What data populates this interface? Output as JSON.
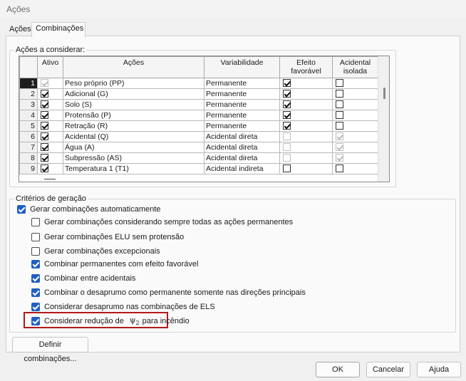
{
  "window": {
    "title": "Ações"
  },
  "tabs": [
    {
      "label": "Ações",
      "active": false
    },
    {
      "label": "Combinações",
      "active": true
    }
  ],
  "acoes_group": {
    "legend": "Ações a considerar:",
    "columns": [
      "",
      "Ativo",
      "Ações",
      "Variabilidade",
      "Efeito favorável",
      "Acidental isolada"
    ],
    "rows": [
      {
        "num": "1",
        "ativo": true,
        "ativo_disabled": true,
        "acao": "Peso próprio (PP)",
        "variabilidade": "Permanente",
        "efeito_favoravel": true,
        "efeito_disabled": false,
        "acidental_isolada": false,
        "acidental_disabled": false,
        "current": true
      },
      {
        "num": "2",
        "ativo": true,
        "ativo_disabled": false,
        "acao": "Adicional (G)",
        "variabilidade": "Permanente",
        "efeito_favoravel": true,
        "efeito_disabled": false,
        "acidental_isolada": false,
        "acidental_disabled": false
      },
      {
        "num": "3",
        "ativo": true,
        "ativo_disabled": false,
        "acao": "Solo (S)",
        "variabilidade": "Permanente",
        "efeito_favoravel": true,
        "efeito_disabled": false,
        "acidental_isolada": false,
        "acidental_disabled": false
      },
      {
        "num": "4",
        "ativo": true,
        "ativo_disabled": false,
        "acao": "Protensão (P)",
        "variabilidade": "Permanente",
        "efeito_favoravel": true,
        "efeito_disabled": false,
        "acidental_isolada": false,
        "acidental_disabled": false
      },
      {
        "num": "5",
        "ativo": true,
        "ativo_disabled": false,
        "acao": "Retração (R)",
        "variabilidade": "Permanente",
        "efeito_favoravel": true,
        "efeito_disabled": false,
        "acidental_isolada": false,
        "acidental_disabled": false
      },
      {
        "num": "6",
        "ativo": true,
        "ativo_disabled": false,
        "acao": "Acidental (Q)",
        "variabilidade": "Acidental direta",
        "efeito_favoravel": false,
        "efeito_disabled": true,
        "acidental_isolada": true,
        "acidental_disabled": true
      },
      {
        "num": "7",
        "ativo": true,
        "ativo_disabled": false,
        "acao": "Água (A)",
        "variabilidade": "Acidental direta",
        "efeito_favoravel": false,
        "efeito_disabled": true,
        "acidental_isolada": true,
        "acidental_disabled": true
      },
      {
        "num": "8",
        "ativo": true,
        "ativo_disabled": false,
        "acao": "Subpressão (AS)",
        "variabilidade": "Acidental direta",
        "efeito_favoravel": false,
        "efeito_disabled": true,
        "acidental_isolada": true,
        "acidental_disabled": true
      },
      {
        "num": "9",
        "ativo": true,
        "ativo_disabled": false,
        "acao": "Temperatura 1 (T1)",
        "variabilidade": "Acidental indireta",
        "efeito_favoravel": false,
        "efeito_disabled": false,
        "acidental_isolada": false,
        "acidental_disabled": false
      }
    ]
  },
  "criterios": {
    "legend": "Critérios de geração",
    "auto": {
      "label": "Gerar combinações automaticamente",
      "checked": true
    },
    "options": [
      {
        "label": "Gerar combinações considerando sempre todas as ações permanentes",
        "checked": false
      },
      {
        "label": "Gerar combinações ELU sem protensão",
        "checked": false
      },
      {
        "label": "Gerar combinações excepcionais",
        "checked": false
      },
      {
        "label": "Combinar permanentes com efeito favorável",
        "checked": true
      },
      {
        "label": "Combinar entre acidentais",
        "checked": true
      },
      {
        "label": "Combinar o desaprumo como permanente somente nas direções principais",
        "checked": true
      },
      {
        "label": "Considerar desaprumo nas combinações de ELS",
        "checked": true
      }
    ],
    "incendio": {
      "prefix": "Considerar redução de",
      "symbol": "ψ",
      "subscript": "2",
      "suffix": "para incêndio",
      "checked": true,
      "highlight_color": "#b21a1a"
    }
  },
  "buttons": {
    "definir": "Definir combinações...",
    "ok": "OK",
    "cancelar": "Cancelar",
    "ajuda": "Ajuda"
  },
  "colors": {
    "checkbox_accent": "#1f5fc4"
  }
}
